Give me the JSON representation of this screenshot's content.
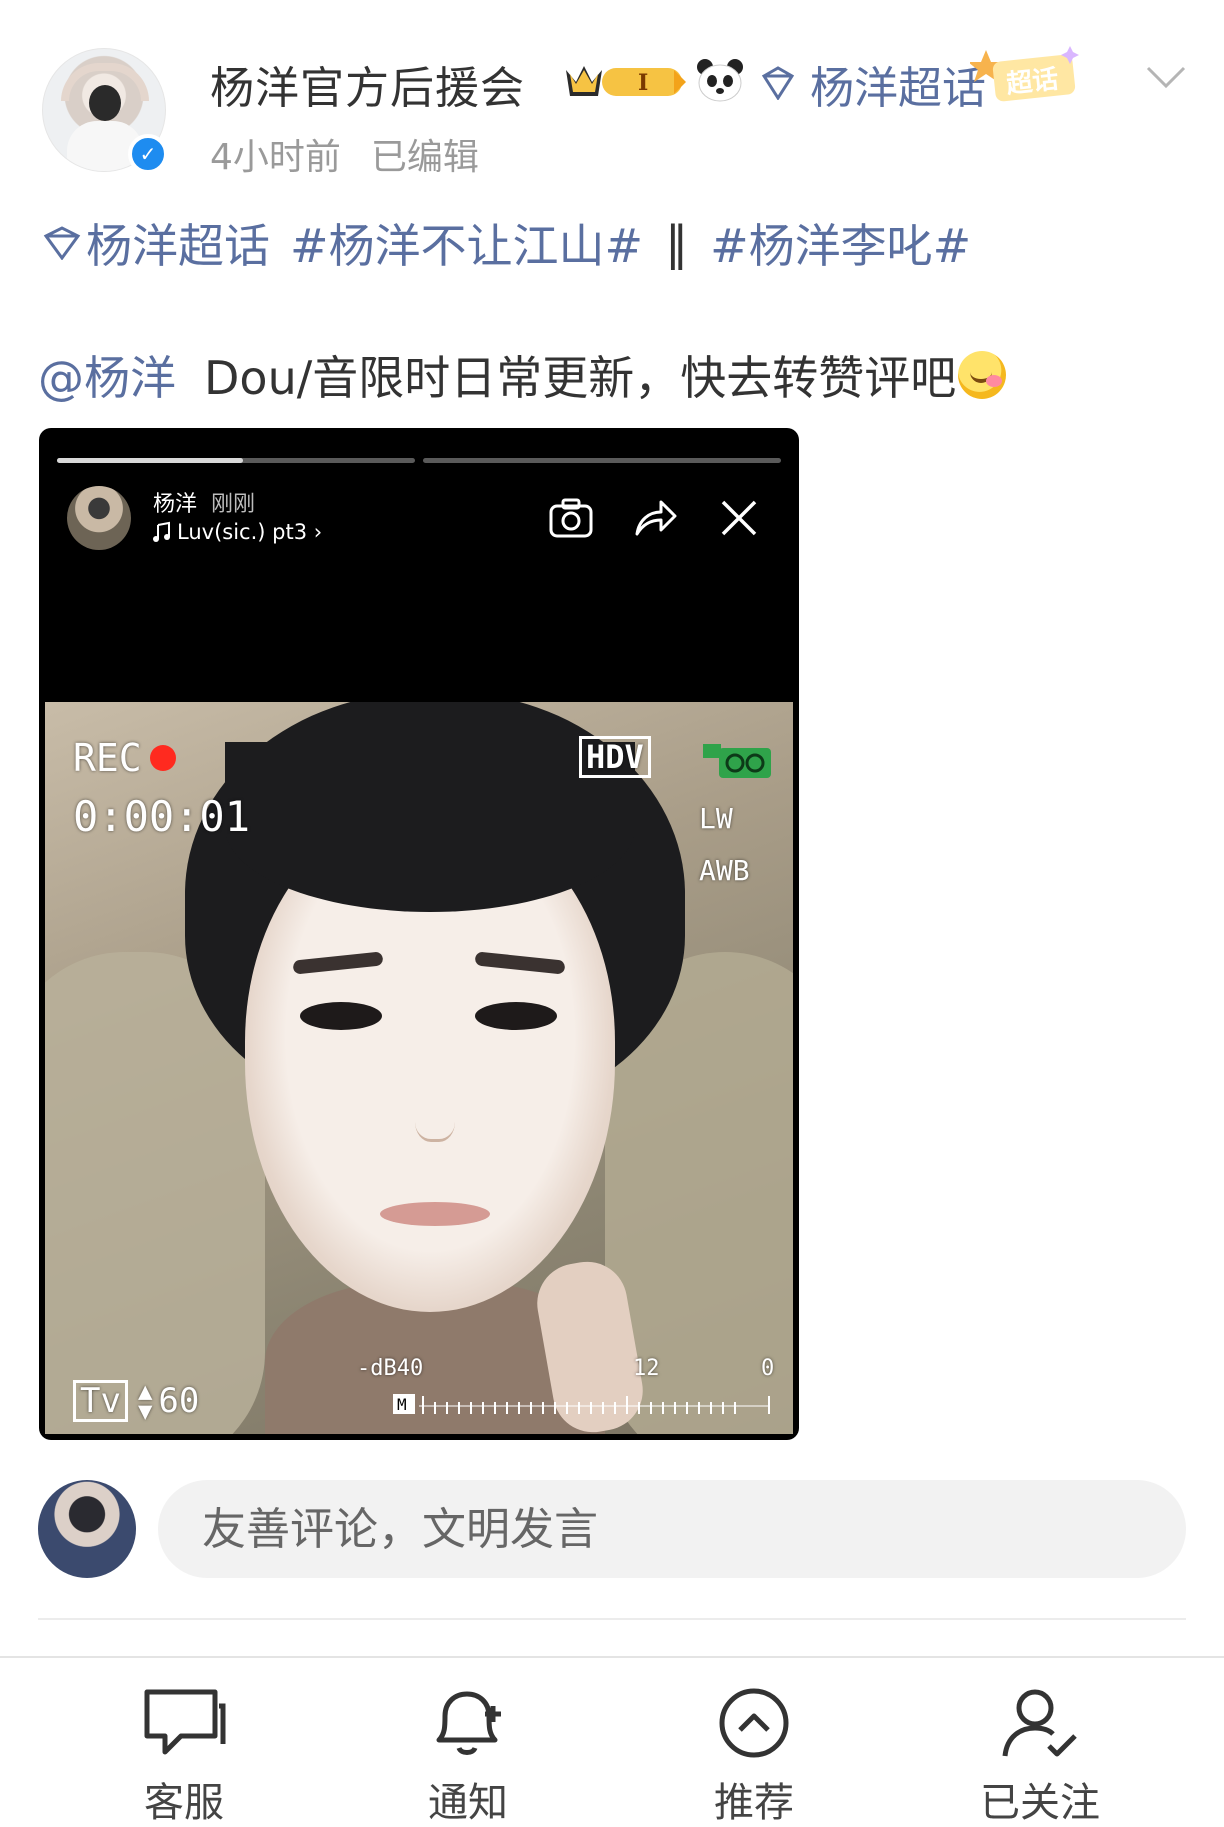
{
  "post": {
    "author_name": "杨洋官方后援会",
    "fan_level_badge": "I",
    "supertopic_link": "杨洋超话",
    "supertopic_tag": "超话",
    "time": "4小时前",
    "edited": "已编辑",
    "topics": {
      "supertopic": "杨洋超话",
      "hashtag_1": "#杨洋不让江山#",
      "separator": "‖",
      "hashtag_2": "#杨洋李叱#"
    },
    "mention": "@杨洋",
    "body_text": "Dou/音限时日常更新，快去转赞评吧"
  },
  "embedded_story": {
    "user_name": "杨洋",
    "time": "刚刚",
    "music": "Luv(sic.) pt3",
    "music_chevron": "›",
    "progress_segments": [
      0.52,
      0.0
    ],
    "camcorder": {
      "rec": "REC",
      "timecode": "0:00:01",
      "hdv": "HDV",
      "lw": "LW",
      "awb": "AWB",
      "tv": "Tv",
      "shutter": "60",
      "db_label": "-dB40",
      "level_12": "12",
      "level_0": "0",
      "meter_label": "M"
    }
  },
  "comment": {
    "placeholder": "友善评论，文明发言"
  },
  "bottom_bar": {
    "tabs": [
      {
        "label": "客服",
        "icon": "chat-bubble-icon"
      },
      {
        "label": "通知",
        "icon": "bell-plus-icon"
      },
      {
        "label": "推荐",
        "icon": "chevron-up-circle-icon"
      },
      {
        "label": "已关注",
        "icon": "user-check-icon"
      }
    ]
  },
  "colors": {
    "link_blue": "#5a6fa0",
    "verified_blue": "#1e8cf0",
    "rec_red": "#ff2a1f",
    "gold": "#f6c343"
  }
}
